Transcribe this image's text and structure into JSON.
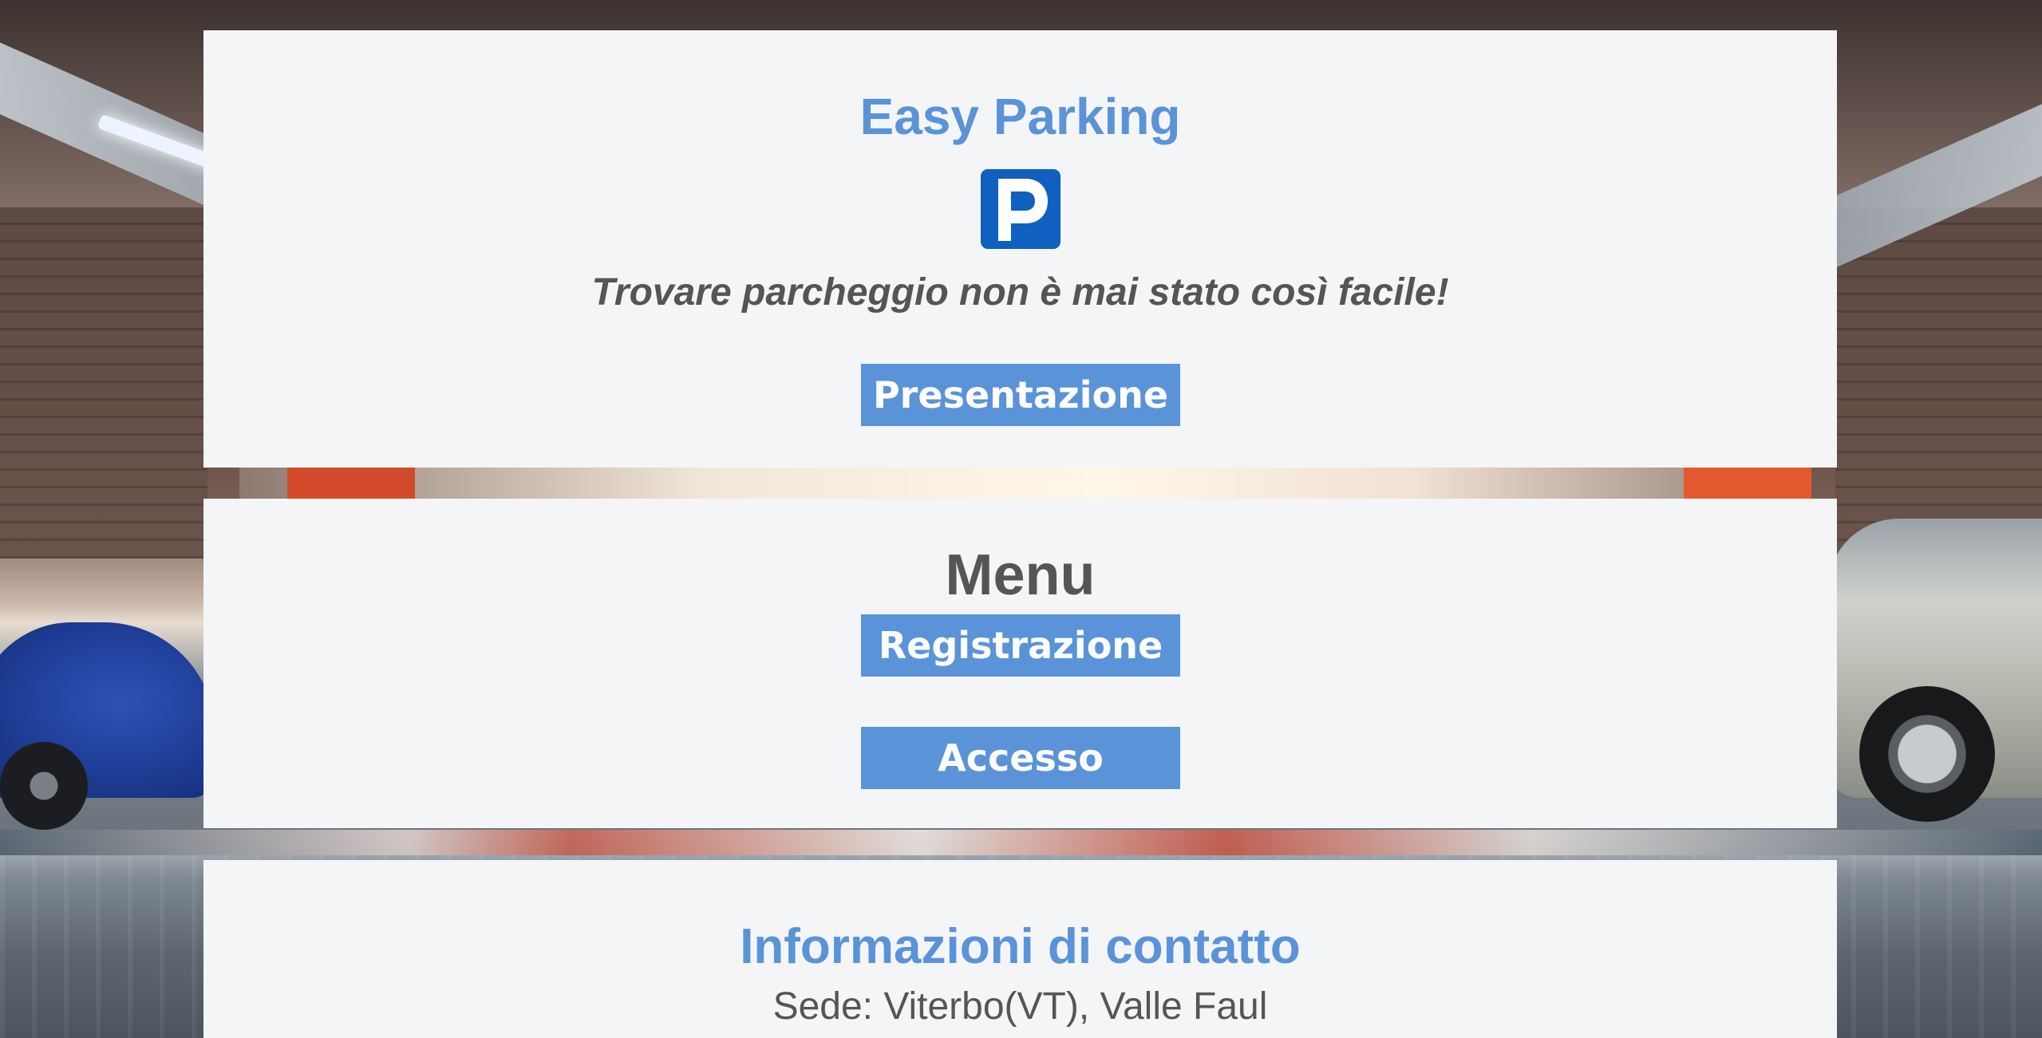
{
  "header": {
    "title": "Easy Parking",
    "logo_icon": "parking-wifi-icon",
    "tagline": "Trovare parcheggio non è mai stato così facile!",
    "presentation_button": "Presentazione"
  },
  "menu": {
    "title": "Menu",
    "register_button": "Registrazione",
    "login_button": "Accesso"
  },
  "contact": {
    "title": "Informazioni di contatto",
    "address": "Sede: Viterbo(VT), Valle Faul"
  },
  "colors": {
    "accent": "#5b93d8",
    "panel_bg": "#f4f5f7",
    "text_dark": "#555555",
    "logo_blue": "#0f60c0"
  }
}
